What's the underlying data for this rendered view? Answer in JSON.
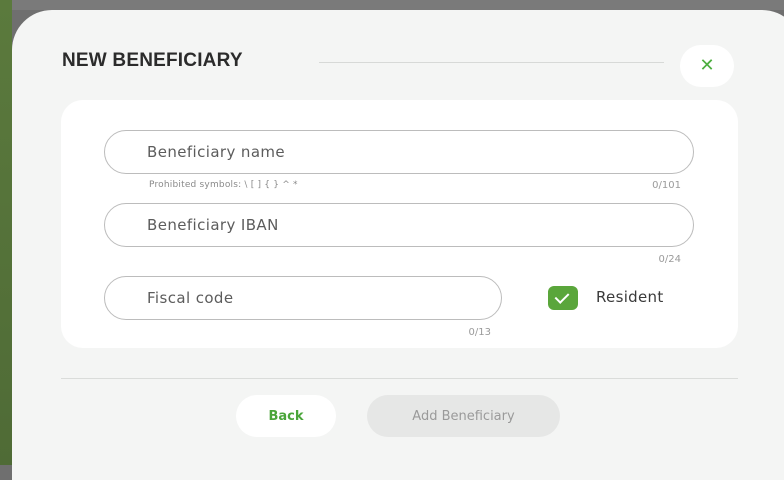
{
  "dialog": {
    "title": "NEW BENEFICIARY",
    "close_icon": "close-icon",
    "accent_color": "#4cae3f"
  },
  "form": {
    "name": {
      "placeholder": "Beneficiary name",
      "value": "",
      "hint": "Prohibited symbols: \\ [ ] { } ^ *",
      "counter": "0/101"
    },
    "iban": {
      "placeholder": "Beneficiary IBAN",
      "value": "",
      "counter": "0/24"
    },
    "fiscal": {
      "placeholder": "Fiscal code",
      "value": "",
      "counter": "0/13"
    },
    "resident": {
      "label": "Resident",
      "checked": true,
      "check_color": "#5aa63b"
    }
  },
  "footer": {
    "back_label": "Back",
    "add_label": "Add Beneficiary",
    "add_disabled": true
  }
}
